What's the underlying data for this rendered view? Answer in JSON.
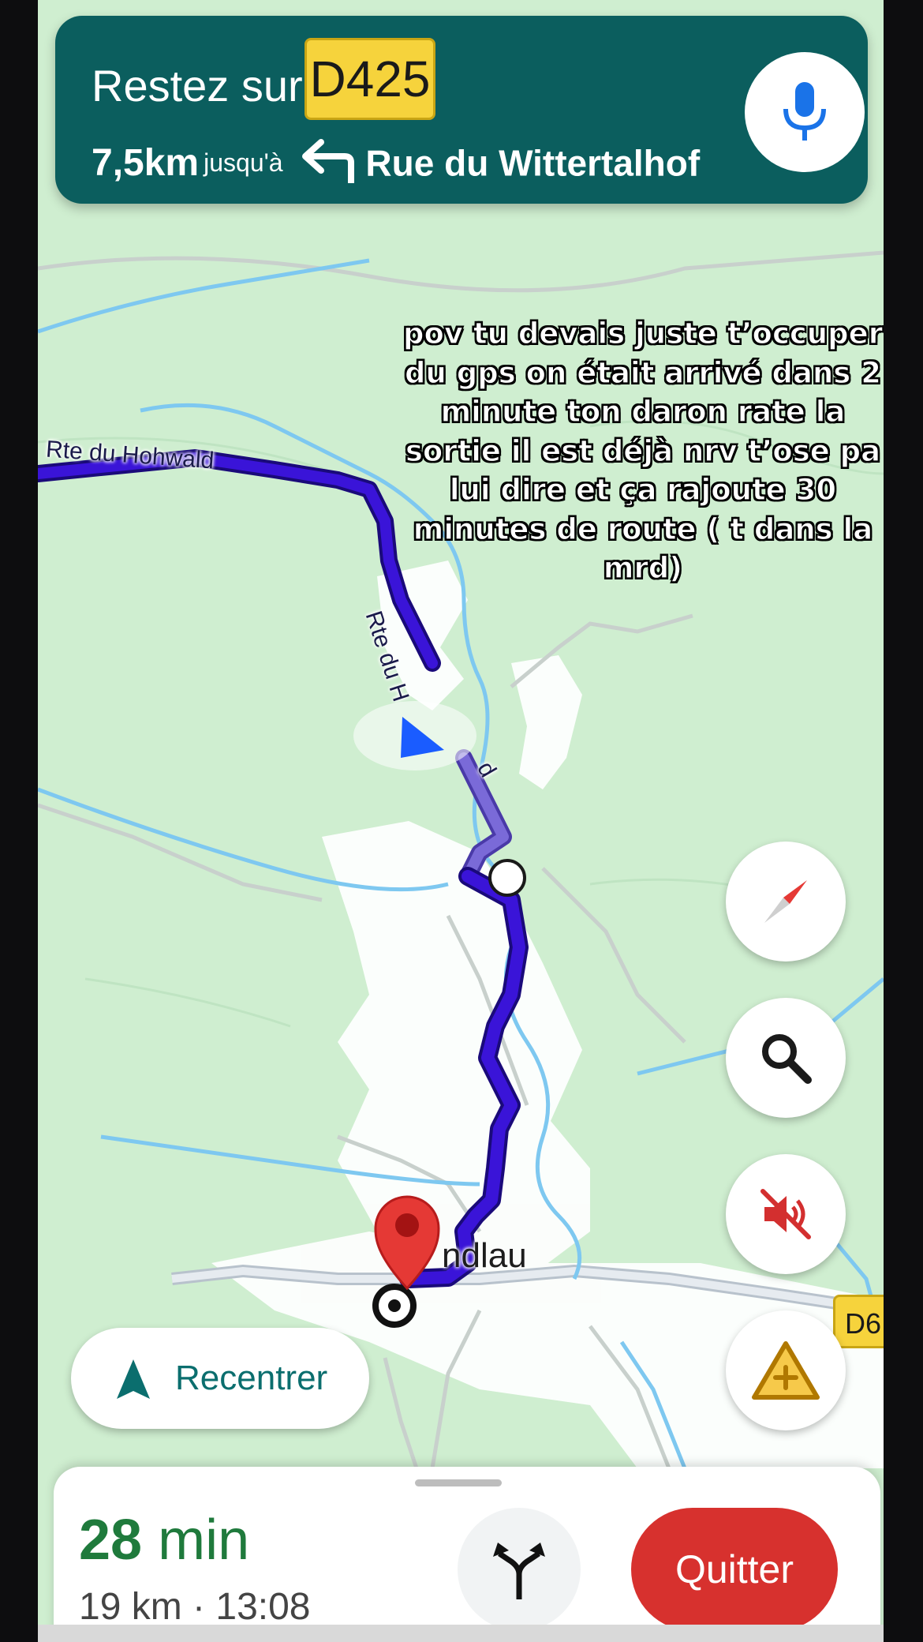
{
  "navigation": {
    "instruction_prefix": "Restez sur",
    "road_shield": "D425",
    "distance": "7,5km",
    "distance_suffix": "jusqu'à",
    "next_road": "Rue du Wittertalhof",
    "turn_icon": "turn-left-icon",
    "mic_icon": "microphone-icon"
  },
  "caption": "pov tu devais juste t’occuper du gps on était arrivé dans 2 minute ton daron rate la sortie il est déjà nrv t’ose pa lui dire et ça rajoute 30 minutes de route ( t dans la mrd)",
  "map": {
    "labels": {
      "road_west": "Rte du Hohwald",
      "road_vertical": "Rte du H",
      "road_fragment": "d",
      "town": "ndlau"
    },
    "shield_east": "D6",
    "colors": {
      "background": "#cfeed0",
      "route": "#3a14d8",
      "route_outline": "#1a0a7a",
      "route_passed": "#7a6ad8",
      "water": "#7ec8f0",
      "urban": "#ffffff",
      "banner": "#0b5e5e",
      "shield": "#f6d33c",
      "quit": "#d7312e",
      "eta_green": "#1f7a3c"
    }
  },
  "controls": {
    "compass_icon": "compass-icon",
    "search_icon": "search-icon",
    "mute_icon": "sound-off-icon",
    "report_icon": "add-incident-icon",
    "recenter_label": "Recentrer"
  },
  "bottom_sheet": {
    "eta_minutes": "28",
    "eta_unit": "min",
    "trip_summary": "19 km · 13:08",
    "alternatives_icon": "alternate-routes-icon",
    "quit_label": "Quitter"
  }
}
